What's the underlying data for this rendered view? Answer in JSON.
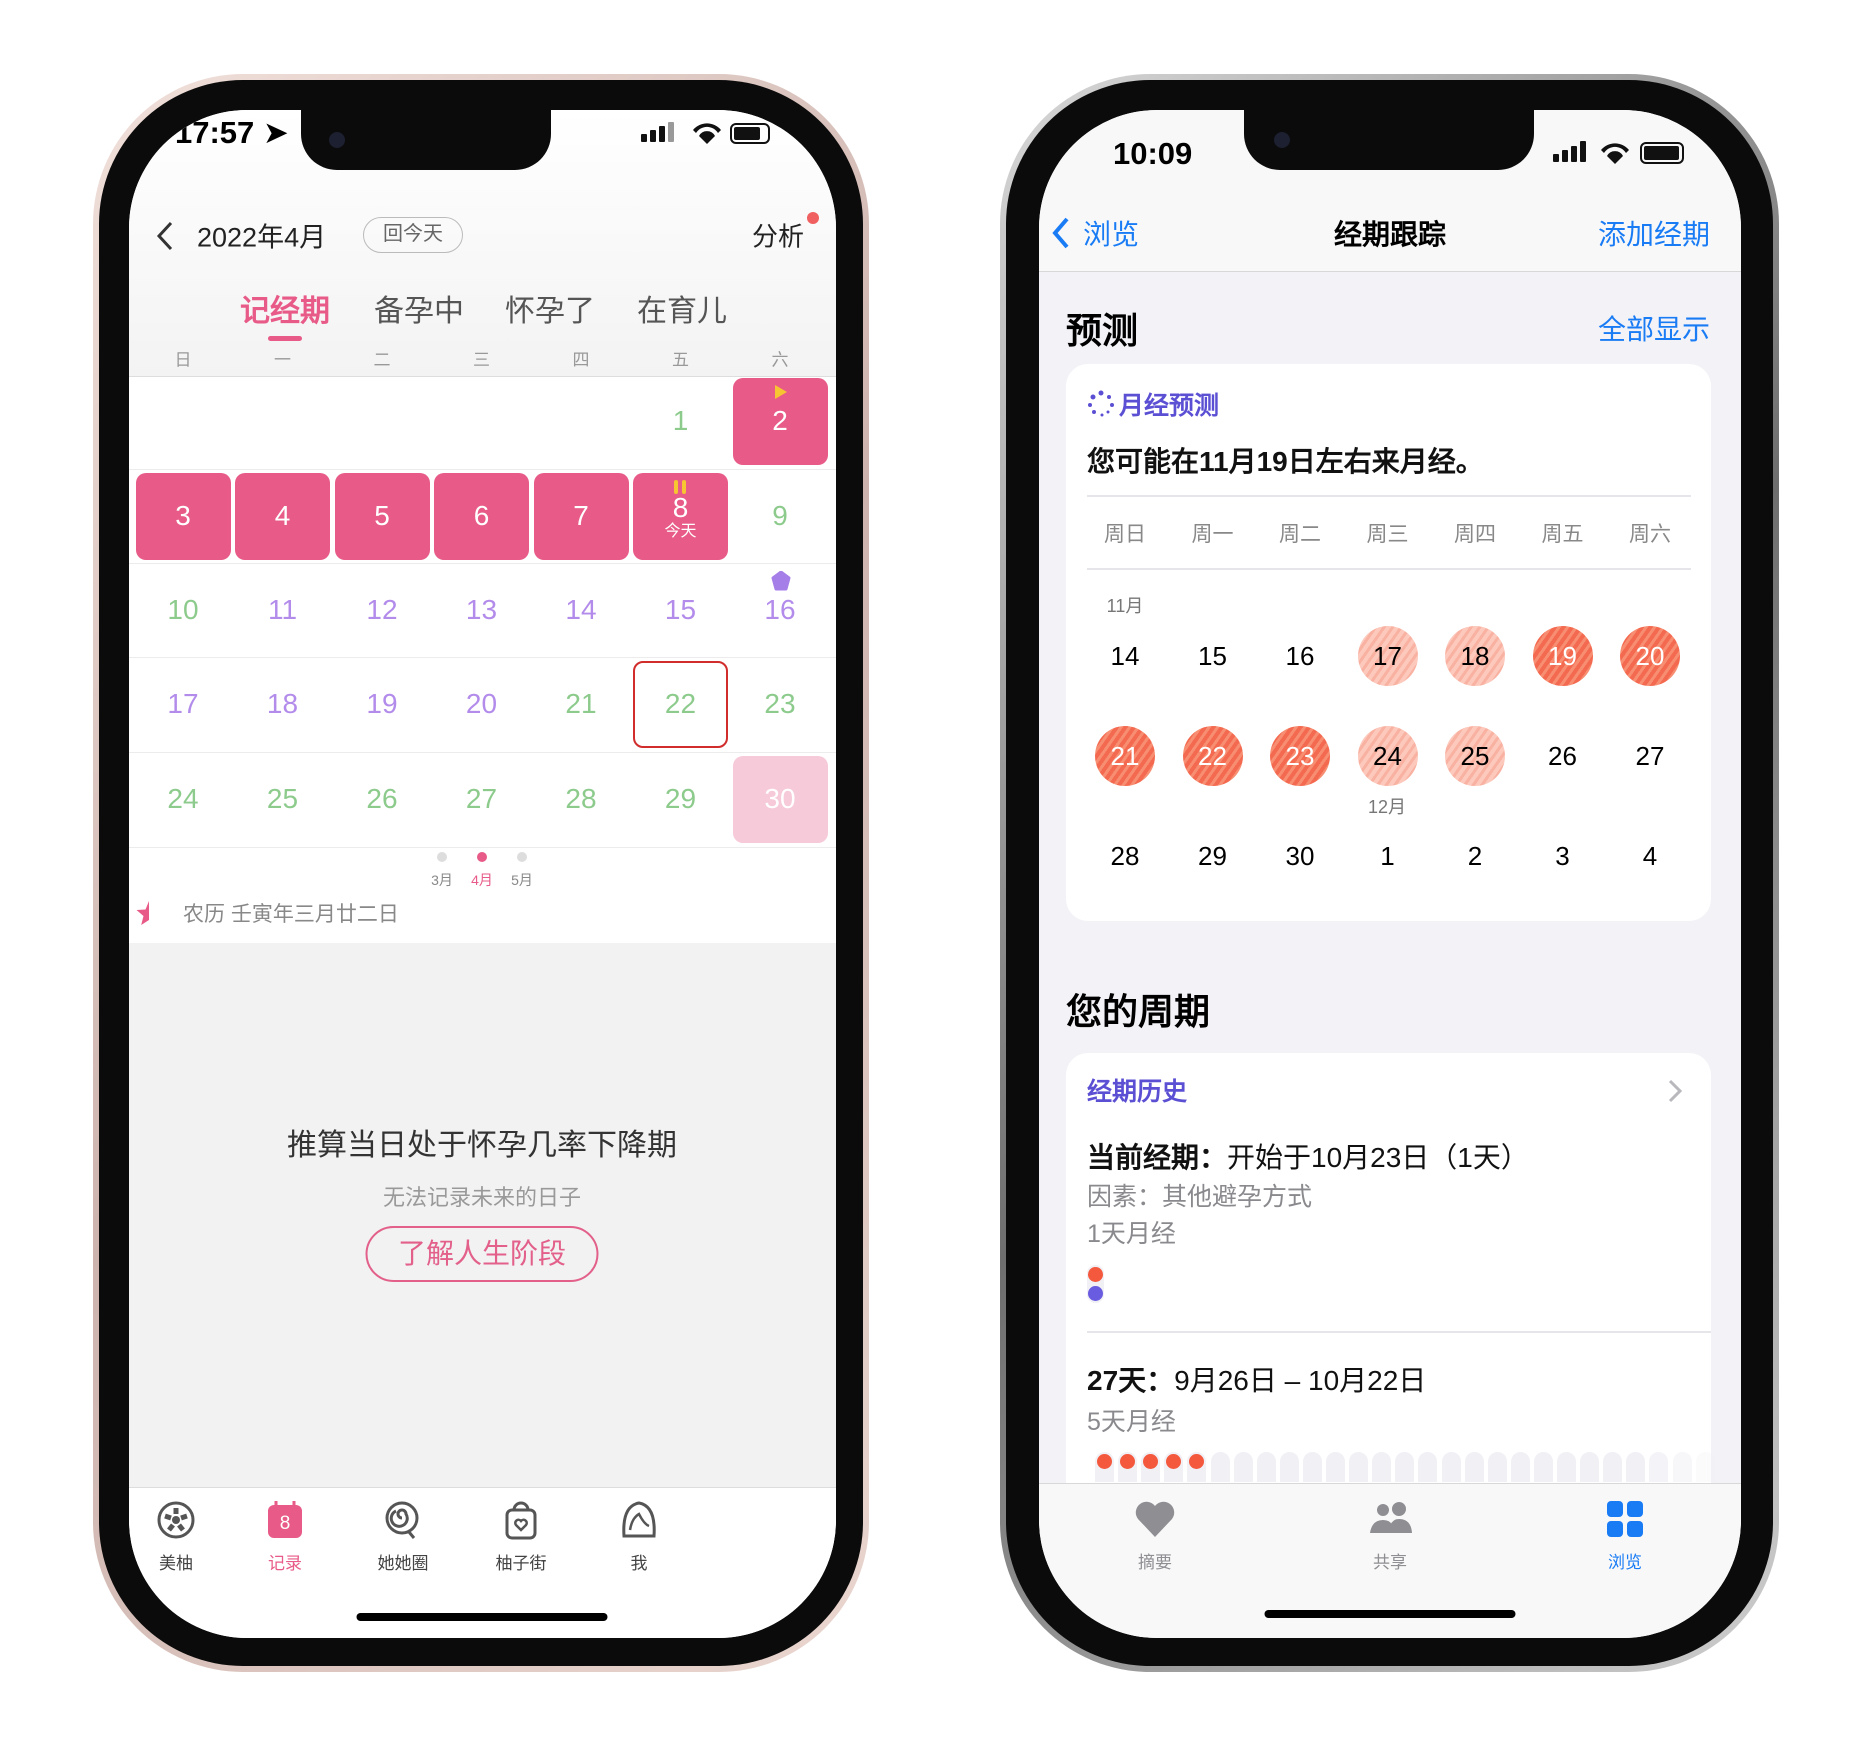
{
  "left_phone": {
    "status": {
      "time": "17:57"
    },
    "header": {
      "month_title": "2022年4月",
      "today_button": "回今天",
      "analysis_link": "分析"
    },
    "mode_tabs": [
      {
        "label": "记经期",
        "active": true
      },
      {
        "label": "备孕中",
        "active": false
      },
      {
        "label": "怀孕了",
        "active": false
      },
      {
        "label": "在育儿",
        "active": false
      }
    ],
    "weekdays": [
      "日",
      "一",
      "二",
      "三",
      "四",
      "五",
      "六"
    ],
    "calendar_rows": [
      [
        {
          "d": ""
        },
        {
          "d": ""
        },
        {
          "d": ""
        },
        {
          "d": ""
        },
        {
          "d": ""
        },
        {
          "d": "1",
          "type": "safe"
        },
        {
          "d": "2",
          "type": "period",
          "icon": "period-start-flag-icon"
        }
      ],
      [
        {
          "d": "3",
          "type": "period"
        },
        {
          "d": "4",
          "type": "period"
        },
        {
          "d": "5",
          "type": "period"
        },
        {
          "d": "6",
          "type": "period"
        },
        {
          "d": "7",
          "type": "period"
        },
        {
          "d": "8",
          "type": "period",
          "icon": "pause-icon",
          "sub": "今天"
        },
        {
          "d": "9",
          "type": "safe"
        }
      ],
      [
        {
          "d": "10",
          "type": "safe"
        },
        {
          "d": "11",
          "type": "ovulation"
        },
        {
          "d": "12",
          "type": "ovulation"
        },
        {
          "d": "13",
          "type": "ovulation"
        },
        {
          "d": "14",
          "type": "ovulation"
        },
        {
          "d": "15",
          "type": "ovulation"
        },
        {
          "d": "16",
          "type": "ovulation",
          "icon": "flower-icon"
        }
      ],
      [
        {
          "d": "17",
          "type": "ovulation"
        },
        {
          "d": "18",
          "type": "ovulation"
        },
        {
          "d": "19",
          "type": "ovulation"
        },
        {
          "d": "20",
          "type": "ovulation"
        },
        {
          "d": "21",
          "type": "safe"
        },
        {
          "d": "22",
          "type": "safe",
          "selected": true
        },
        {
          "d": "23",
          "type": "safe"
        }
      ],
      [
        {
          "d": "24",
          "type": "safe"
        },
        {
          "d": "25",
          "type": "safe"
        },
        {
          "d": "26",
          "type": "safe"
        },
        {
          "d": "27",
          "type": "safe"
        },
        {
          "d": "28",
          "type": "safe"
        },
        {
          "d": "29",
          "type": "safe"
        },
        {
          "d": "30",
          "type": "predicted-period"
        }
      ]
    ],
    "month_pager": [
      {
        "label": "3月",
        "active": false
      },
      {
        "label": "4月",
        "active": true
      },
      {
        "label": "5月",
        "active": false
      }
    ],
    "lunar": "农历 壬寅年三月廿二日",
    "info": {
      "title": "推算当日处于怀孕几率下降期",
      "subtitle": "无法记录未来的日子",
      "button": "了解人生阶段"
    },
    "tab_bar": [
      {
        "label": "美柚",
        "icon": "pomelo-icon",
        "active": false
      },
      {
        "label": "记录",
        "icon": "calendar-icon",
        "badge": "8",
        "active": true
      },
      {
        "label": "她她圈",
        "icon": "community-icon",
        "active": false
      },
      {
        "label": "柚子街",
        "icon": "shopping-bag-icon",
        "active": false
      },
      {
        "label": "我",
        "icon": "profile-icon",
        "active": false
      }
    ],
    "colors": {
      "accent": "#e85a87",
      "safe": "#8dcb8d",
      "ovulation": "#b38ceb",
      "predicted": "#f6cad8",
      "selected_outline": "#d12d2d"
    }
  },
  "right_phone": {
    "status": {
      "time": "10:09"
    },
    "nav": {
      "back_label": "浏览",
      "title": "经期跟踪",
      "action": "添加经期"
    },
    "prediction": {
      "section_title": "预测",
      "show_all": "全部显示",
      "card_title": "月经预测",
      "sentence": "您可能在11月19日左右来月经。",
      "weekdays": [
        "周日",
        "周一",
        "周二",
        "周三",
        "周四",
        "周五",
        "周六"
      ],
      "month_labels": {
        "nov": "11月",
        "dec": "12月"
      },
      "rows": [
        [
          {
            "d": "14"
          },
          {
            "d": "15"
          },
          {
            "d": "16"
          },
          {
            "d": "17",
            "level": "light"
          },
          {
            "d": "18",
            "level": "light"
          },
          {
            "d": "19",
            "level": "dark"
          },
          {
            "d": "20",
            "level": "dark"
          }
        ],
        [
          {
            "d": "21",
            "level": "dark"
          },
          {
            "d": "22",
            "level": "dark"
          },
          {
            "d": "23",
            "level": "dark"
          },
          {
            "d": "24",
            "level": "light"
          },
          {
            "d": "25",
            "level": "light"
          },
          {
            "d": "26"
          },
          {
            "d": "27"
          }
        ],
        [
          {
            "d": "28"
          },
          {
            "d": "29"
          },
          {
            "d": "30"
          },
          {
            "d": "1"
          },
          {
            "d": "2"
          },
          {
            "d": "3"
          },
          {
            "d": "4"
          }
        ]
      ]
    },
    "cycles": {
      "section_title": "您的周期",
      "history_title": "经期历史",
      "current": {
        "label": "当前经期：",
        "value": "开始于10月23日（1天）",
        "factor": "因素：其他避孕方式",
        "length": "1天月经"
      },
      "previous": {
        "label": "27天：",
        "value": "9月26日 – 10月22日",
        "length": "5天月经",
        "cycle_days": 27,
        "period_days": 5
      }
    },
    "tab_bar": [
      {
        "label": "摘要",
        "icon": "heart-icon",
        "active": false
      },
      {
        "label": "共享",
        "icon": "people-icon",
        "active": false
      },
      {
        "label": "浏览",
        "icon": "grid-icon",
        "active": true
      }
    ],
    "colors": {
      "tint": "#1a7cf5",
      "purple": "#5b4fd3",
      "period": "#f4583d",
      "fertile_dot": "#6a5ce0"
    }
  }
}
